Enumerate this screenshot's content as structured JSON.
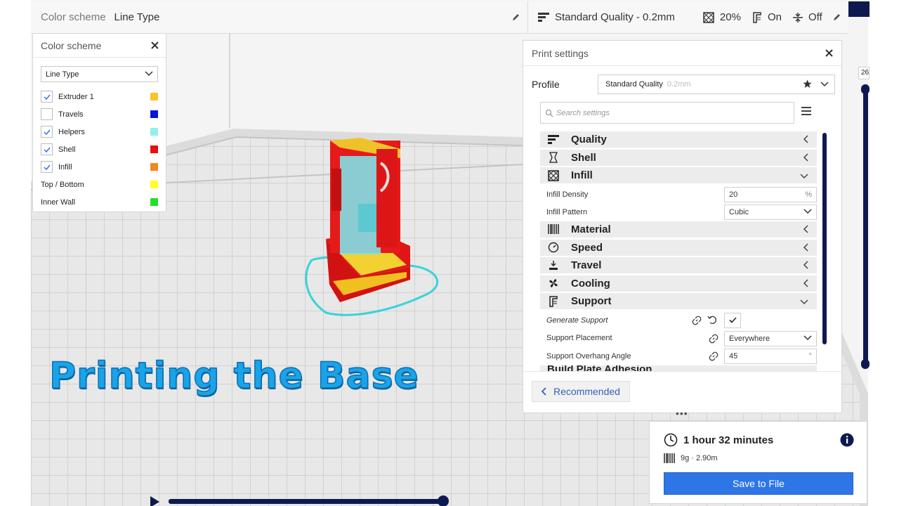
{
  "topbar": {
    "color_scheme_label": "Color scheme",
    "color_scheme_value": "Line Type",
    "profile": "Standard Quality - 0.2mm",
    "infill": "20%",
    "support": "On",
    "adhesion": "Off"
  },
  "color_scheme_panel": {
    "title": "Color scheme",
    "selected": "Line Type",
    "items": [
      {
        "label": "Extruder 1",
        "checked": true,
        "color": "#f8c52a"
      },
      {
        "label": "Travels",
        "checked": false,
        "color": "#0a14d6"
      },
      {
        "label": "Helpers",
        "checked": true,
        "color": "#8ff0f0"
      },
      {
        "label": "Shell",
        "checked": true,
        "color": "#e81010"
      },
      {
        "label": "Infill",
        "checked": true,
        "color": "#f08a1a"
      },
      {
        "label": "Top / Bottom",
        "checked": null,
        "color": "#ffff2a"
      },
      {
        "label": "Inner Wall",
        "checked": null,
        "color": "#22e02a"
      }
    ]
  },
  "overlay": {
    "title": "Printing the Base"
  },
  "print_settings": {
    "title": "Print settings",
    "profile_label": "Profile",
    "profile_name": "Standard Quality",
    "profile_layer": "0.2mm",
    "search_placeholder": "Search settings",
    "categories": {
      "quality": "Quality",
      "shell": "Shell",
      "infill": "Infill",
      "material": "Material",
      "speed": "Speed",
      "travel": "Travel",
      "cooling": "Cooling",
      "support": "Support",
      "adhesion_partial": "Build Plate Adhesion"
    },
    "settings": {
      "infill_density_label": "Infill Density",
      "infill_density_value": "20",
      "infill_density_unit": "%",
      "infill_pattern_label": "Infill Pattern",
      "infill_pattern_value": "Cubic",
      "generate_support_label": "Generate Support",
      "generate_support_checked": true,
      "support_placement_label": "Support Placement",
      "support_placement_value": "Everywhere",
      "support_overhang_label": "Support Overhang Angle",
      "support_overhang_value": "45",
      "support_overhang_unit": "°"
    },
    "recommended_label": "Recommended"
  },
  "estimate": {
    "time": "1 hour 32 minutes",
    "material": "9g · 2.90m",
    "save_label": "Save to File"
  },
  "layer_slider": {
    "value": "26"
  },
  "colors": {
    "accent": "#2e76e8",
    "dark_navy": "#0e1a4f",
    "overlay_text": "#1aa3e8"
  }
}
